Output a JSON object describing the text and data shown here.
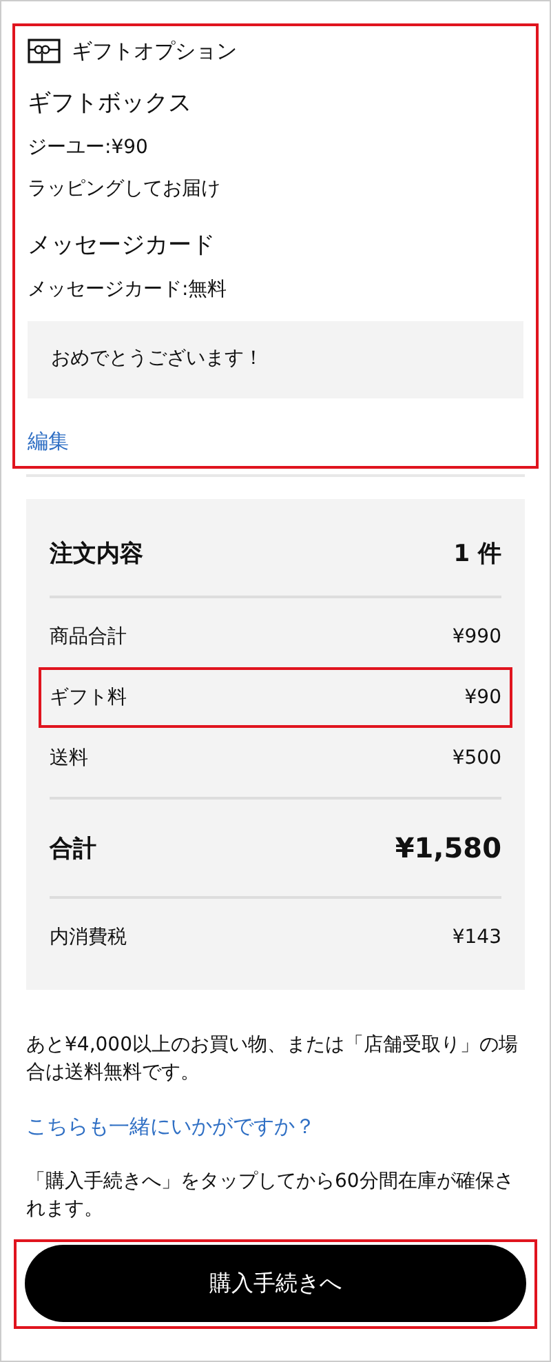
{
  "gift_option": {
    "title": "ギフトオプション",
    "highlighted": true,
    "gift_box": {
      "heading": "ギフトボックス",
      "lines": [
        "ジーユー:¥90",
        "ラッピングしてお届け"
      ]
    },
    "message_card": {
      "heading": "メッセージカード",
      "lines": [
        "メッセージカード:無料"
      ],
      "message": "おめでとうございます！"
    },
    "edit_link": "編集"
  },
  "order_summary": {
    "title": "注文内容",
    "count": "1 件",
    "rows": [
      {
        "kind": "line",
        "label": "商品合計",
        "value": "¥990",
        "highlighted": false
      },
      {
        "kind": "line",
        "label": "ギフト料",
        "value": "¥90",
        "highlighted": true
      },
      {
        "kind": "line",
        "label": "送料",
        "value": "¥500",
        "highlighted": false
      },
      {
        "kind": "total",
        "label": "合計",
        "value": "¥1,580",
        "highlighted": false
      },
      {
        "kind": "line",
        "label": "内消費税",
        "value": "¥143",
        "highlighted": false
      }
    ]
  },
  "shipping_note": "あと¥4,000以上のお買い物、または「店舗受取り」の場合は送料無料です。",
  "suggest_link": "こちらも一緒にいかがですか？",
  "stock_note": "「購入手続きへ」をタップしてから60分間在庫が確保されます。",
  "checkout": {
    "label": "購入手続きへ",
    "highlighted": true
  }
}
